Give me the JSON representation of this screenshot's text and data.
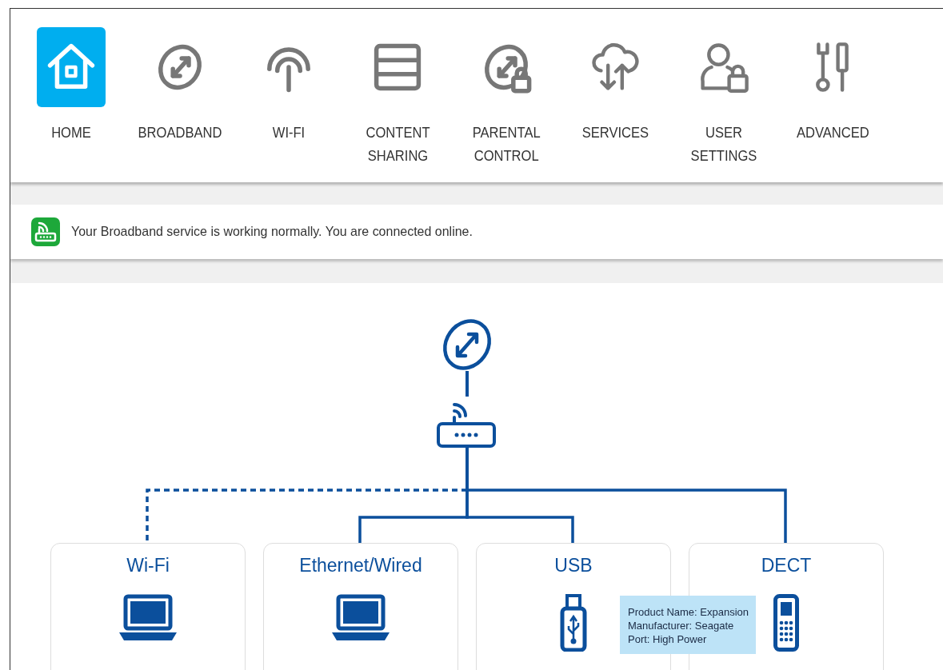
{
  "nav": [
    {
      "kind": "home",
      "lines": [
        "HOME"
      ],
      "selected": true
    },
    {
      "kind": "globe",
      "lines": [
        "BROADBAND"
      ],
      "selected": false
    },
    {
      "kind": "wifi",
      "lines": [
        "WI-FI"
      ],
      "selected": false
    },
    {
      "kind": "storage",
      "lines": [
        "CONTENT",
        "SHARING"
      ],
      "selected": false
    },
    {
      "kind": "globe-lock",
      "lines": [
        "PARENTAL",
        "CONTROL"
      ],
      "selected": false
    },
    {
      "kind": "cloud",
      "lines": [
        "SERVICES"
      ],
      "selected": false
    },
    {
      "kind": "user-lock",
      "lines": [
        "USER",
        "SETTINGS"
      ],
      "selected": false
    },
    {
      "kind": "tools",
      "lines": [
        "ADVANCED"
      ],
      "selected": false
    }
  ],
  "status": {
    "ok": true,
    "message": "Your Broadband service is working normally. You are connected online."
  },
  "devices": [
    {
      "title": "Wi-Fi",
      "kind": "laptop",
      "wireless": true
    },
    {
      "title": "Ethernet/Wired",
      "kind": "laptop",
      "wireless": false
    },
    {
      "title": "USB",
      "kind": "usb",
      "wireless": false,
      "tooltip": [
        "Product Name: Expansion",
        "Manufacturer: Seagate",
        "Port: High Power"
      ]
    },
    {
      "title": "DECT",
      "kind": "phone",
      "wireless": false
    }
  ]
}
